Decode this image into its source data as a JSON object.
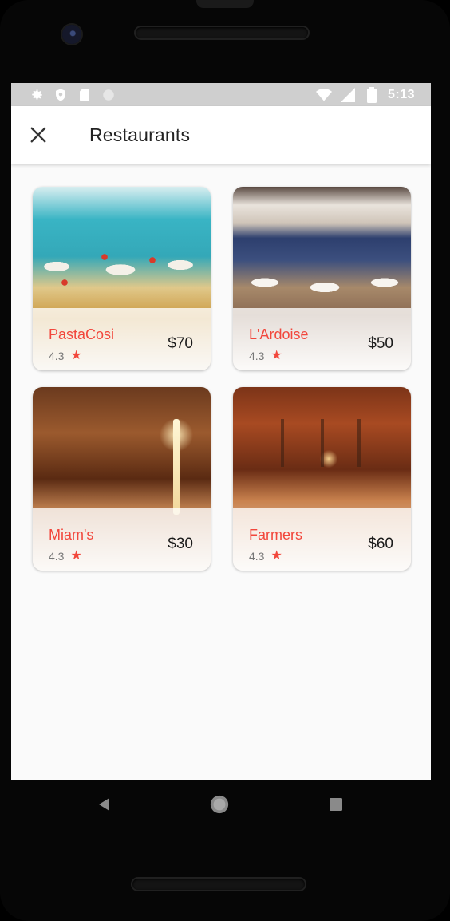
{
  "statusbar": {
    "time": "5:13",
    "icons_left": [
      "gear-icon",
      "shield-icon",
      "sd-card-icon",
      "circle-icon"
    ],
    "icons_right": [
      "wifi-icon",
      "signal-icon",
      "battery-icon"
    ]
  },
  "appbar": {
    "title": "Restaurants",
    "close_icon": "close-icon"
  },
  "restaurants": [
    {
      "name": "PastaCosi",
      "rating": "4.3",
      "price": "$70"
    },
    {
      "name": "L'Ardoise",
      "rating": "4.3",
      "price": "$50"
    },
    {
      "name": "Miam's",
      "rating": "4.3",
      "price": "$30"
    },
    {
      "name": "Farmers",
      "rating": "4.3",
      "price": "$60"
    }
  ],
  "colors": {
    "accent": "#f2473c",
    "statusbar": "#cfcfcf",
    "background": "#fafafa"
  },
  "navbar": {
    "buttons": [
      "back-icon",
      "home-icon",
      "recents-icon"
    ]
  }
}
